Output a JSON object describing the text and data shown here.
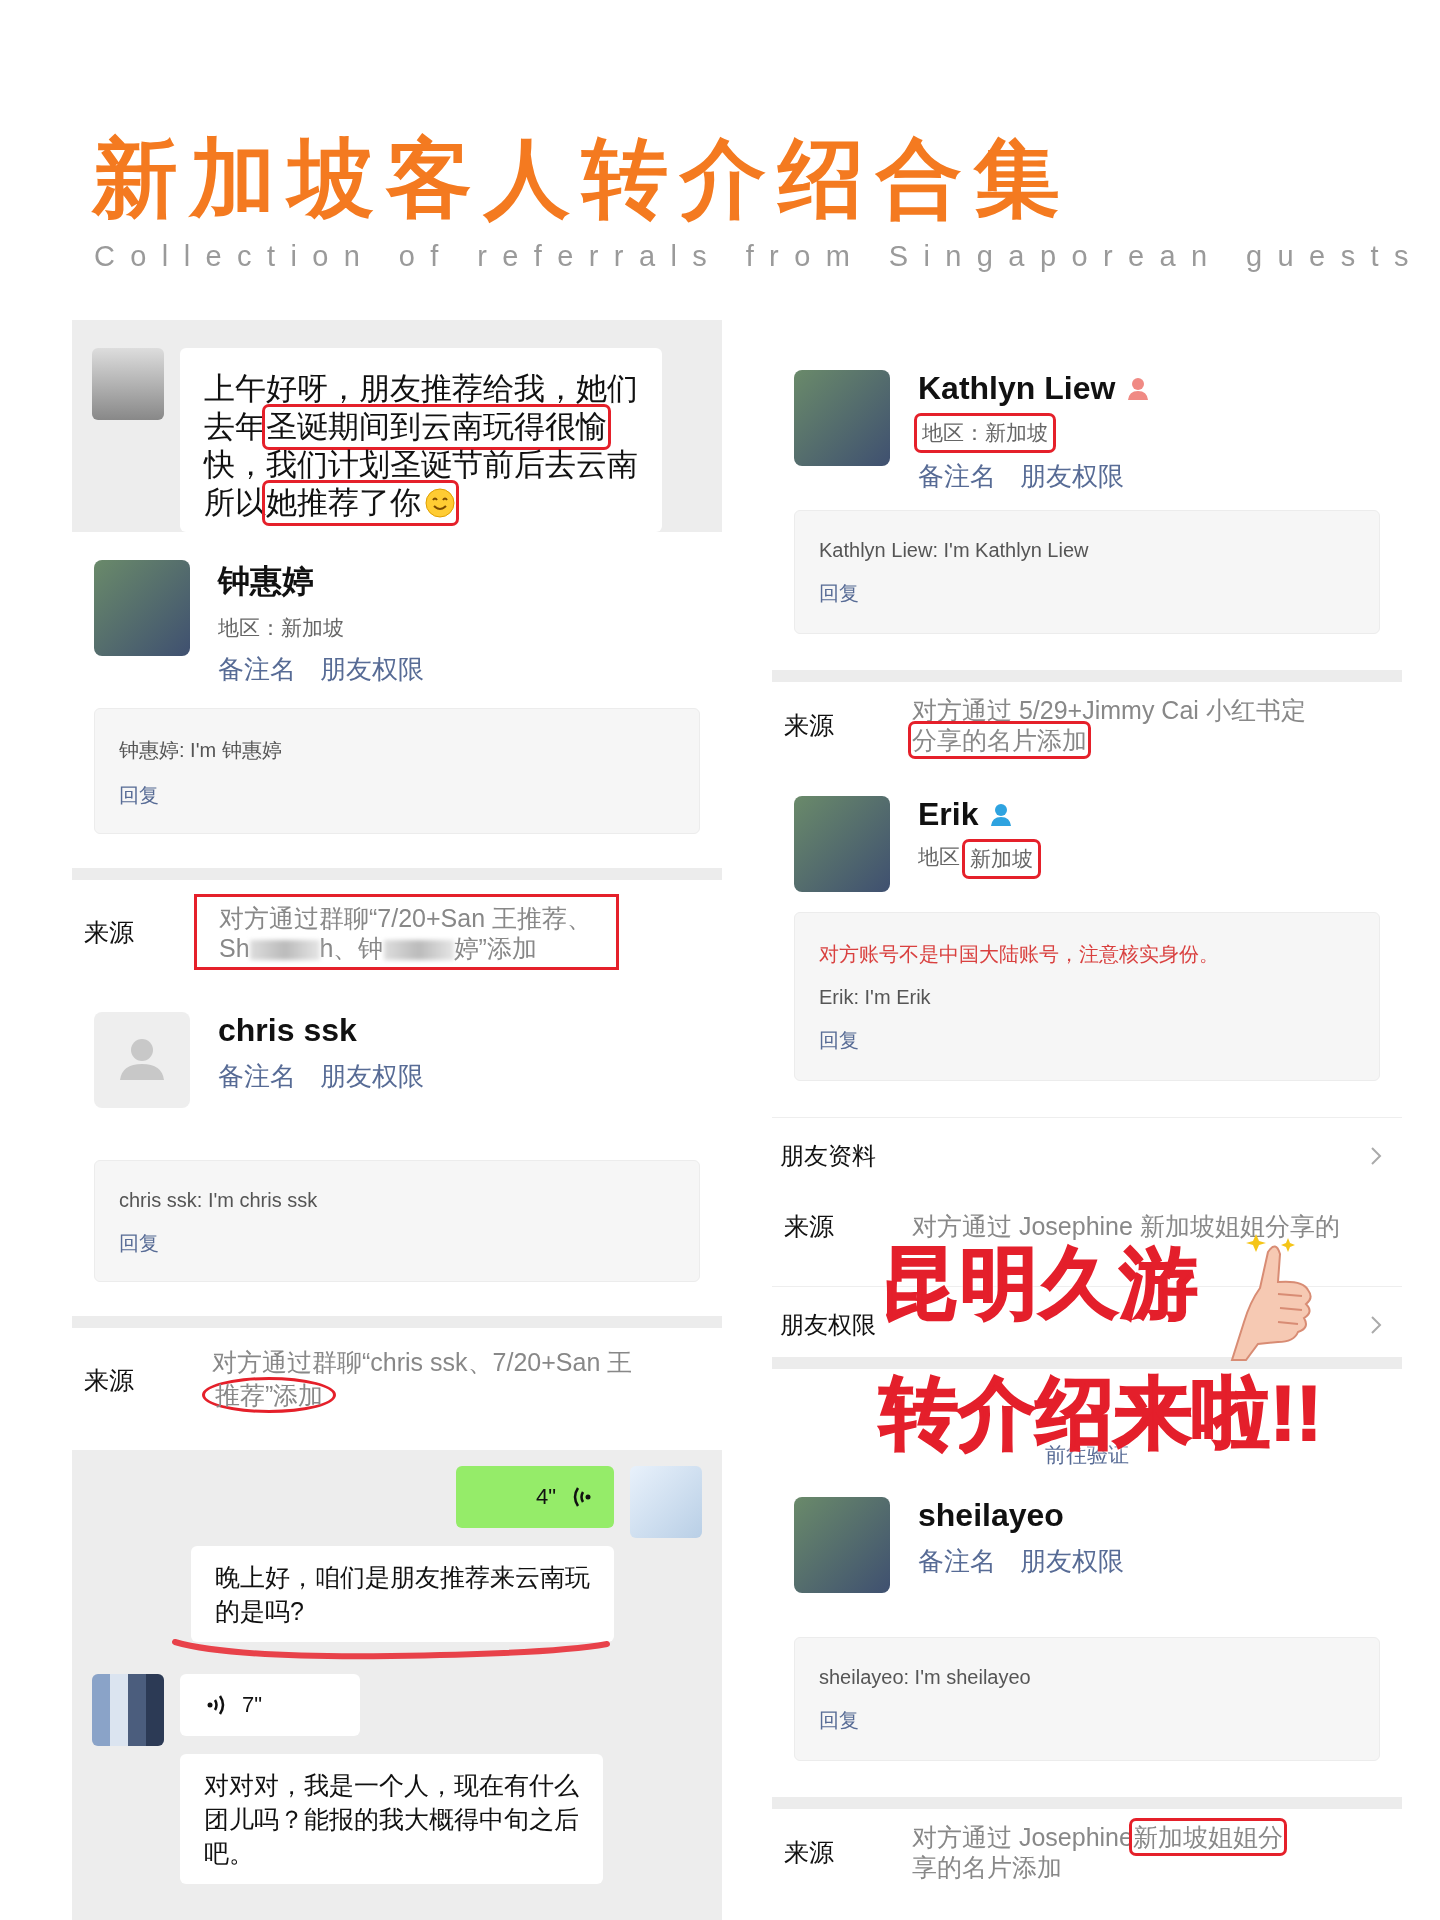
{
  "title": "新加坡客人转介绍合集",
  "subtitle": "Collection of referrals from Singaporean guests",
  "columns": [
    {
      "blocks": [
        {
          "kind": "chat",
          "messages": [
            {
              "kind": "received_text",
              "underlined": false,
              "lines": [
                [
                  {
                    "kind": "plain",
                    "text": "上午好呀，朋友推荐给我，她们"
                  }
                ],
                [
                  {
                    "kind": "plain",
                    "text": "去年"
                  },
                  {
                    "kind": "boxed",
                    "text": "圣诞期间到云南玩得很愉"
                  }
                ],
                [
                  {
                    "kind": "plain",
                    "text": "快，我们计划圣诞节前后去云南"
                  }
                ],
                [
                  {
                    "kind": "plain",
                    "text": "所以"
                  },
                  {
                    "kind": "boxed",
                    "text": "她推荐了你",
                    "emoji": true
                  }
                ]
              ]
            }
          ]
        },
        {
          "kind": "profile",
          "name": "钟惠婷",
          "avatar": {
            "kind": "photo"
          },
          "region": [
            {
              "kind": "plain",
              "text": "地区：新加坡"
            }
          ],
          "links": [
            "备注名",
            "朋友权限"
          ]
        },
        {
          "kind": "message",
          "lines": [
            {
              "text": "钟惠婷: I'm 钟惠婷",
              "warning": false
            }
          ],
          "reply": "回复"
        },
        {
          "kind": "divider"
        },
        {
          "kind": "source",
          "label": "来源",
          "framed": true,
          "lines": [
            [
              {
                "kind": "plain",
                "text": "对方通过群聊“7/20+San  王推荐、"
              }
            ],
            [
              {
                "kind": "plain",
                "text": "Sh"
              },
              {
                "kind": "redacted"
              },
              {
                "kind": "plain",
                "text": "h、钟"
              },
              {
                "kind": "redacted"
              },
              {
                "kind": "plain",
                "text": "婷”添加"
              }
            ]
          ]
        },
        {
          "kind": "profile",
          "name": "chris ssk",
          "avatar": {
            "kind": "default"
          },
          "links": [
            "备注名",
            "朋友权限"
          ]
        },
        {
          "kind": "message",
          "lines": [
            {
              "text": "chris ssk: I'm chris ssk",
              "warning": false
            }
          ],
          "reply": "回复"
        },
        {
          "kind": "divider"
        },
        {
          "kind": "source",
          "label": "来源",
          "framed": false,
          "lines": [
            [
              {
                "kind": "plain",
                "text": "对方通过群聊“chris ssk、7/20+San  王"
              }
            ],
            [
              {
                "kind": "circled",
                "text": "推荐”添加"
              }
            ]
          ]
        },
        {
          "kind": "chat",
          "messages": [
            {
              "kind": "sent_voice",
              "underlined": false,
              "duration": "4\""
            },
            {
              "kind": "sent_text",
              "underlined": true,
              "lines": [
                [
                  {
                    "kind": "plain",
                    "text": "晚上好，咱们是朋友推荐来云南玩"
                  }
                ],
                [
                  {
                    "kind": "plain",
                    "text": "的是吗?"
                  }
                ]
              ]
            },
            {
              "kind": "received_voice",
              "underlined": false,
              "duration": "7\""
            },
            {
              "kind": "received_text",
              "underlined": false,
              "lines": [
                [
                  {
                    "kind": "plain",
                    "text": "对对对，我是一个人，现在有什么"
                  }
                ],
                [
                  {
                    "kind": "plain",
                    "text": "团儿吗？能报的我大概得中旬之后"
                  }
                ],
                [
                  {
                    "kind": "plain",
                    "text": "吧。"
                  }
                ]
              ]
            }
          ]
        }
      ]
    },
    {
      "blocks": [
        {
          "kind": "profile",
          "name": "Kathlyn Liew",
          "color": "#f08a84",
          "avatar": {
            "kind": "photo"
          },
          "region": [
            {
              "kind": "boxed",
              "text": "地区：新加坡"
            }
          ],
          "links": [
            "备注名",
            "朋友权限"
          ]
        },
        {
          "kind": "message",
          "lines": [
            {
              "text": "Kathlyn Liew: I'm Kathlyn Liew",
              "warning": false
            }
          ],
          "reply": "回复"
        },
        {
          "kind": "divider"
        },
        {
          "kind": "source",
          "label": "来源",
          "framed": false,
          "lines": [
            [
              {
                "kind": "plain",
                "text": "对方通过 5/29+Jimmy Cai 小红书定"
              }
            ],
            [
              {
                "kind": "boxed",
                "text": "分享的名片添加"
              }
            ]
          ]
        },
        {
          "kind": "profile",
          "name": "Erik",
          "color": "#2ea3e0",
          "avatar": {
            "kind": "photo"
          },
          "region": [
            {
              "kind": "plain",
              "text": "地区"
            },
            {
              "kind": "boxed",
              "text": "新加坡"
            }
          ]
        },
        {
          "kind": "message",
          "lines": [
            {
              "text": "对方账号不是中国大陆账号，注意核实身份。",
              "warning": true
            },
            {
              "text": "Erik: I'm Erik",
              "warning": false
            }
          ],
          "reply": "回复"
        },
        {
          "kind": "rule"
        },
        {
          "kind": "menu",
          "label": "朋友资料"
        },
        {
          "kind": "source",
          "label": "来源",
          "framed": false,
          "lines": [
            [
              {
                "kind": "plain",
                "text": "对方通过 Josephine  新加坡姐姐分享的"
              }
            ]
          ]
        },
        {
          "kind": "rule"
        },
        {
          "kind": "menu",
          "label": "朋友权限"
        },
        {
          "kind": "divider"
        },
        {
          "kind": "verify",
          "text": "前往验证"
        },
        {
          "kind": "profile",
          "name": "sheilayeo",
          "avatar": {
            "kind": "photo"
          },
          "links": [
            "备注名",
            "朋友权限"
          ]
        },
        {
          "kind": "message",
          "lines": [
            {
              "text": "sheilayeo: I'm sheilayeo",
              "warning": false
            }
          ],
          "reply": "回复"
        },
        {
          "kind": "divider"
        },
        {
          "kind": "source",
          "label": "来源",
          "framed": false,
          "lines": [
            [
              {
                "kind": "plain",
                "text": "对方通过 Josephine "
              },
              {
                "kind": "boxed",
                "text": "新加坡姐姐分"
              }
            ],
            [
              {
                "kind": "plain",
                "text": "享的名片添加"
              }
            ]
          ]
        }
      ]
    }
  ],
  "overlay": {
    "lines": [
      "昆明久游",
      "转介绍来啦!!"
    ]
  }
}
